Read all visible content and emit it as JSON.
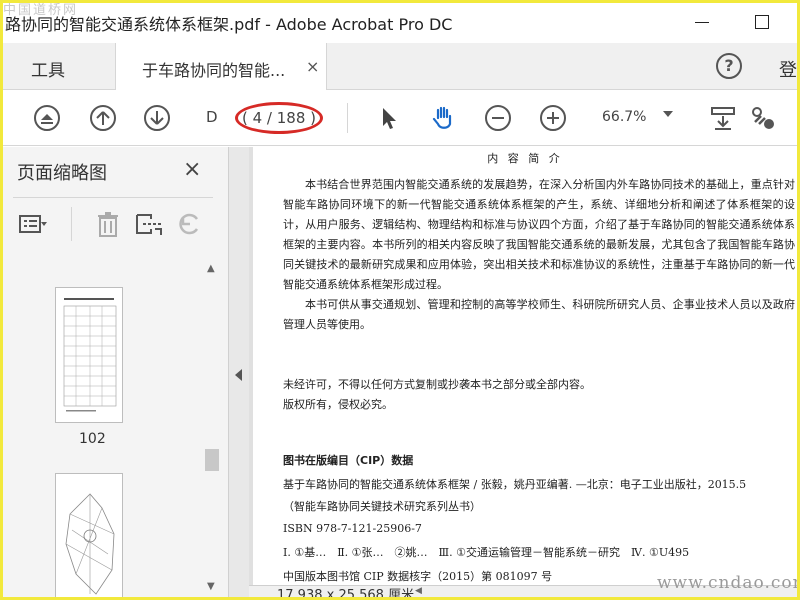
{
  "watermarks": {
    "top": "中国道桥网",
    "bottom": "www.cndao.com"
  },
  "window": {
    "title": "路协同的智能交通系统体系框架.pdf - Adobe Acrobat Pro DC"
  },
  "tabs": {
    "tools_label": "工具",
    "doc_label": "于车路协同的智能...",
    "close": "×",
    "help": "?",
    "login": "登"
  },
  "toolbar": {
    "page_input": "D",
    "page_count": "( 4 / 188 )",
    "zoom": "66.7%"
  },
  "sidebar": {
    "title": "页面缩略图",
    "close": "×",
    "thumb_label_1": "102"
  },
  "document": {
    "heading": "内 容 简 介",
    "para1": "本书结合世界范围内智能交通系统的发展趋势，在深入分析国内外车路协同技术的基础上，重点针对智能车路协同环境下的新一代智能交通系统体系框架的产生，系统、详细地分析和阐述了体系框架的设计，从用户服务、逻辑结构、物理结构和标准与协议四个方面，介绍了基于车路协同的智能交通系统体系框架的主要内容。本书所列的相关内容反映了我国智能交通系统的最新发展，尤其包含了我国智能车路协同关键技术的最新研究成果和应用体验，突出相关技术和标准协议的系统性，注重基于车路协同的新一代智能交通系统体系框架形成过程。",
    "para2": "本书可供从事交通规划、管理和控制的高等学校师生、科研院所研究人员、企事业技术人员以及政府管理人员等使用。",
    "copyright1": "未经许可，不得以任何方式复制或抄袭本书之部分或全部内容。",
    "copyright2": "版权所有，侵权必究。",
    "cip_title": "图书在版编目（CIP）数据",
    "cip_line1": "基于车路协同的智能交通系统体系框架 / 张毅，姚丹亚编著. —北京：电子工业出版社，2015.5",
    "cip_line2": "（智能车路协同关键技术研究系列丛书）",
    "cip_line3": "ISBN 978-7-121-25906-7",
    "cip_line4": "Ⅰ. ①基…　Ⅱ. ①张…　②姚…　Ⅲ. ①交通运输管理－智能系统－研究　Ⅳ. ①U495",
    "cip_line5": "中国版本图书馆 CIP 数据核字（2015）第 081097 号",
    "size_label": "17.938 x 25.568 厘米"
  },
  "colors": {
    "accent_red": "#d62a26",
    "frame_yellow": "#f2e93c",
    "icon_gray": "#555555",
    "hand_blue": "#1b6ac9"
  }
}
